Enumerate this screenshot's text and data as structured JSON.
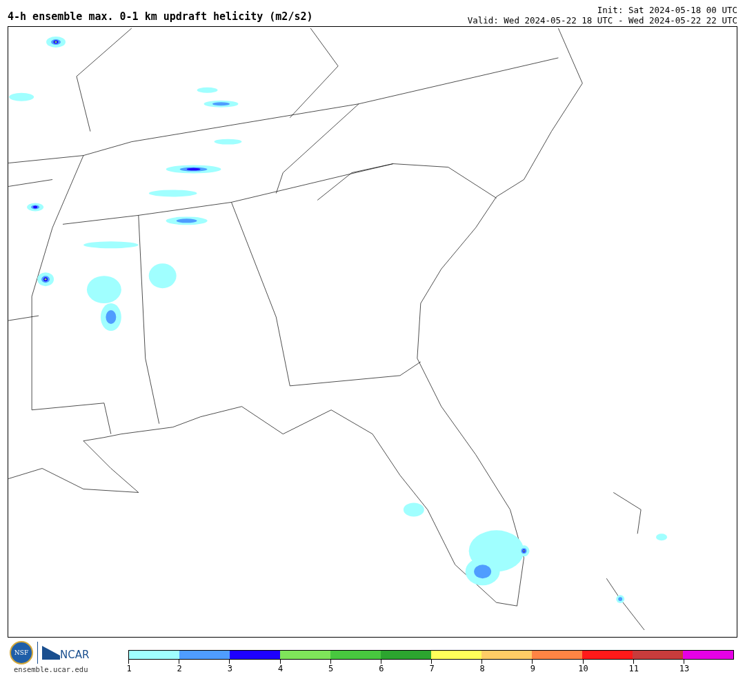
{
  "title": "4-h ensemble max. 0-1 km updraft helicity (m2/s2)",
  "init": "Init: Sat 2024-05-18 00 UTC",
  "valid": "Valid: Wed 2024-05-22 18 UTC - Wed 2024-05-22 22 UTC",
  "logos": {
    "nsf": "NSF",
    "ncar": "NCAR",
    "url": "ensemble.ucar.edu"
  },
  "colorbar": [
    {
      "label": "1",
      "color": "#a0ffff"
    },
    {
      "label": "2",
      "color": "#4f9dff"
    },
    {
      "label": "3",
      "color": "#1e00ff"
    },
    {
      "label": "4",
      "color": "#7fe55a"
    },
    {
      "label": "5",
      "color": "#48c83f"
    },
    {
      "label": "6",
      "color": "#2ca52f"
    },
    {
      "label": "7",
      "color": "#ffff5a"
    },
    {
      "label": "8",
      "color": "#ffcc66"
    },
    {
      "label": "9",
      "color": "#ff8444"
    },
    {
      "label": "10",
      "color": "#ff1a1a"
    },
    {
      "label": "11",
      "color": "#c83c3c"
    },
    {
      "label": "13",
      "color": "#e600e6"
    }
  ]
}
